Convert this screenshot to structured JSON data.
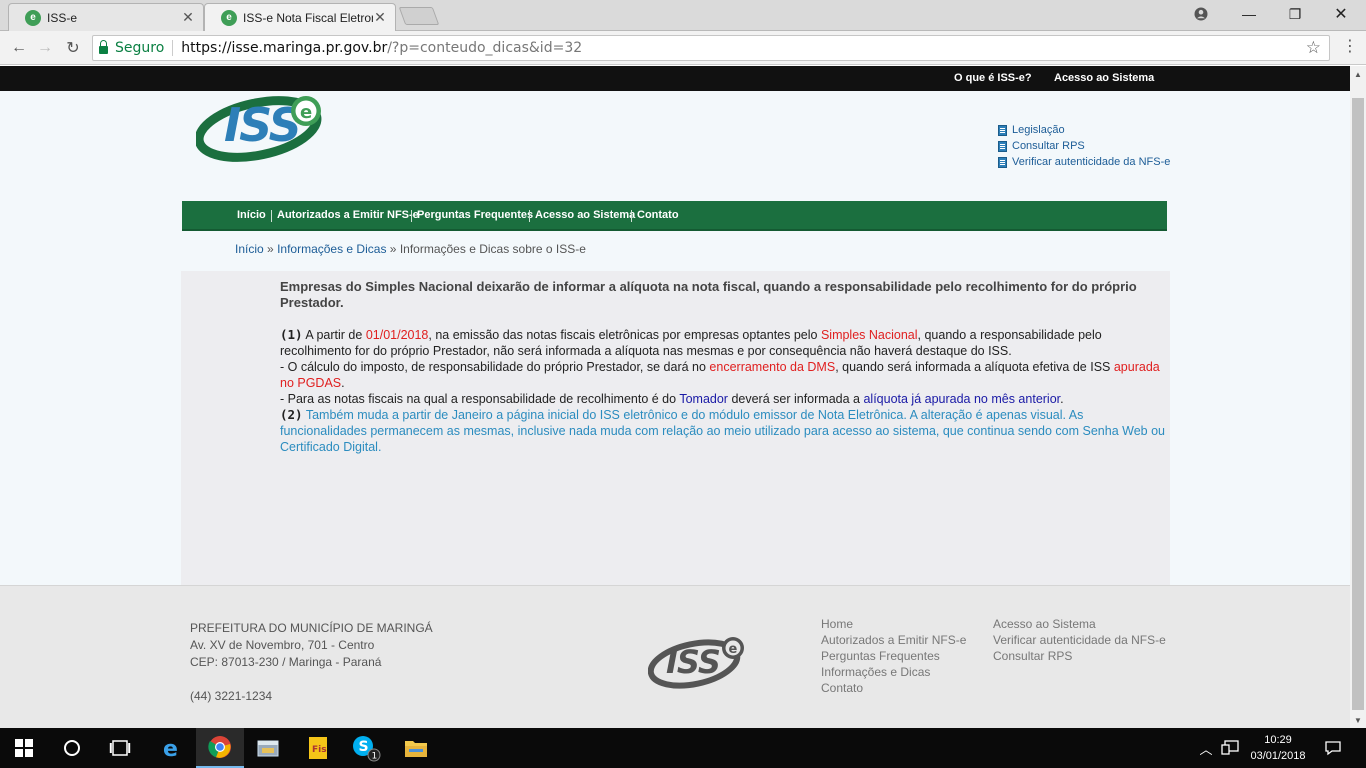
{
  "browser": {
    "tabs": [
      {
        "title": "ISS-e",
        "active": false
      },
      {
        "title": "ISS-e Nota Fiscal Eletroni",
        "active": true
      }
    ],
    "secure_label": "Seguro",
    "url_host": "https://isse.maringa.pr.gov.br",
    "url_path": "/?p=conteudo_dicas&id=32"
  },
  "site": {
    "topbar": {
      "what_is": "O que é ISS-e?",
      "access": "Acesso ao Sistema"
    },
    "logo_text": "ISS",
    "logo_badge": "e",
    "quick_links": [
      "Legislação",
      "Consultar RPS",
      "Verificar autenticidade da NFS-e"
    ],
    "nav": [
      "Início",
      "Autorizados a Emitir NFS-e",
      "Perguntas Frequentes",
      "Acesso ao Sistema",
      "Contato"
    ],
    "breadcrumb": {
      "home": "Início",
      "section": "Informações e Dicas",
      "separator": "»",
      "current": "Informações e Dicas sobre o ISS-e"
    },
    "article": {
      "title": "Empresas do Simples Nacional deixarão de informar a alíquota na nota fiscal, quando a responsabilidade pelo recolhimento for do próprio Prestador.",
      "p1_num": "(1)",
      "p1_a": " A partir de ",
      "p1_date": "01/01/2018",
      "p1_b": ", na emissão das notas fiscais eletrônicas por empresas optantes pelo ",
      "p1_simples": "Simples Nacional",
      "p1_c": ", quando a responsabilidade pelo recolhimento for do próprio Prestador, não será informada a alíquota nas mesmas e por consequência não haverá destaque do ISS.",
      "p2_a": "- O cálculo do imposto, de responsabilidade do próprio Prestador, se dará no ",
      "p2_dms": "encerramento da DMS",
      "p2_b": ", quando será informada a alíquota efetiva de ISS ",
      "p2_pgdas": "apurada no PGDAS",
      "p2_c": ".",
      "p3_a": "- Para as notas fiscais na qual a responsabilidade de recolhimento é do ",
      "p3_tomador": "Tomador",
      "p3_b": " deverá ser informada a ",
      "p3_aliquota": "alíquota já apurada no mês anterior",
      "p3_c": ".",
      "p4_num": "(2)",
      "p4_text": " Também muda a partir de Janeiro a página inicial do ISS eletrônico e do módulo emissor de Nota Eletrônica. A alteração é apenas visual. As funcionalidades permanecem as mesmas, inclusive nada muda com relação ao meio utilizado para acesso ao sistema, que continua sendo com Senha Web ou Certificado Digital."
    },
    "footer": {
      "address": [
        "PREFEITURA DO MUNICÍPIO DE MARINGÁ",
        "Av. XV de Novembro, 701 - Centro",
        "CEP: 87013-230 / Maringa - Paraná",
        "",
        "(44) 3221-1234"
      ],
      "col1": [
        "Home",
        "Autorizados a Emitir NFS-e",
        "Perguntas Frequentes",
        "Informações e Dicas",
        "Contato"
      ],
      "col2": [
        "Acesso ao Sistema",
        "Verificar autenticidade da NFS-e",
        "Consultar RPS"
      ]
    }
  },
  "taskbar": {
    "time": "10:29",
    "date": "03/01/2018",
    "skype_badge": "1"
  },
  "colors": {
    "nav_green": "#1b6f3f",
    "link_blue": "#1d5d97",
    "red": "#e02020",
    "teal": "#2b8cbf"
  }
}
